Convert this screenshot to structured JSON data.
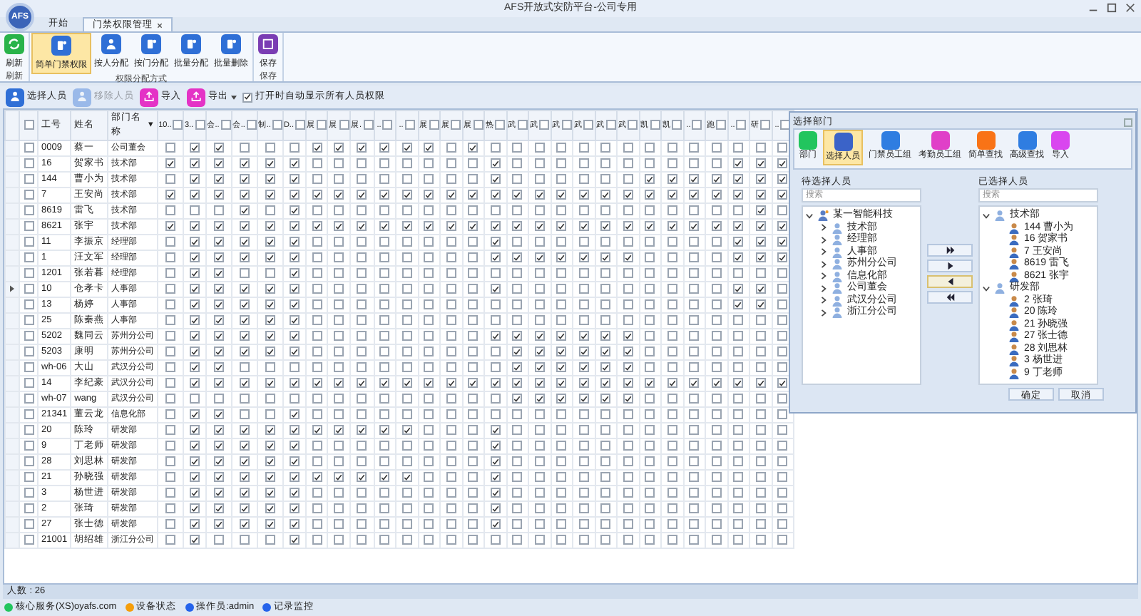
{
  "window": {
    "title": "AFS开放式安防平台-公司专用",
    "logo": "AFS"
  },
  "tabs": [
    {
      "label": "开始",
      "selected": false,
      "closable": false
    },
    {
      "label": "门禁权限管理",
      "selected": true,
      "closable": true
    }
  ],
  "ribbon_groups": [
    {
      "label": "刷新",
      "buttons": [
        {
          "label": "刷新",
          "selected": false
        }
      ]
    },
    {
      "label": "权限分配方式",
      "buttons": [
        {
          "label": "简单门禁权限",
          "selected": true
        },
        {
          "label": "按人分配",
          "selected": false
        },
        {
          "label": "按门分配",
          "selected": false
        },
        {
          "label": "批量分配",
          "selected": false
        },
        {
          "label": "批量删除",
          "selected": false
        }
      ]
    },
    {
      "label": "保存",
      "buttons": [
        {
          "label": "保存",
          "selected": false
        }
      ]
    }
  ],
  "toolbar": {
    "buttons": [
      {
        "label": "选择人员",
        "disabled": false,
        "dropdown": false
      },
      {
        "label": "移除人员",
        "disabled": true,
        "dropdown": false
      },
      {
        "label": "导入",
        "disabled": false,
        "dropdown": false
      },
      {
        "label": "导出",
        "disabled": false,
        "dropdown": true
      }
    ],
    "option": {
      "label": "打开时自动显示所有人员权限",
      "checked": true
    }
  },
  "table": {
    "all_checked": false,
    "columns": [
      "工号",
      "姓名",
      "部门名称"
    ],
    "sort_indicator": "▾",
    "permission_columns": [
      {
        "label": "10..",
        "checked": false
      },
      {
        "label": "3..",
        "checked": false
      },
      {
        "label": "会..",
        "checked": false
      },
      {
        "label": "会..",
        "checked": false
      },
      {
        "label": "制..",
        "checked": false
      },
      {
        "label": "D..",
        "checked": false
      },
      {
        "label": "展",
        "checked": false
      },
      {
        "label": "展",
        "checked": false
      },
      {
        "label": "展.",
        "checked": false
      },
      {
        "label": "..",
        "checked": false
      },
      {
        "label": "..",
        "checked": false
      },
      {
        "label": "展",
        "checked": false
      },
      {
        "label": "展",
        "checked": false
      },
      {
        "label": "展",
        "checked": false
      },
      {
        "label": "热",
        "checked": false
      },
      {
        "label": "武",
        "checked": false
      },
      {
        "label": "武",
        "checked": false
      },
      {
        "label": "武",
        "checked": false
      },
      {
        "label": "武",
        "checked": false
      },
      {
        "label": "武",
        "checked": false
      },
      {
        "label": "武",
        "checked": false
      },
      {
        "label": "凯",
        "checked": false
      },
      {
        "label": "凯",
        "checked": false
      },
      {
        "label": "..",
        "checked": false
      },
      {
        "label": "跑",
        "checked": false
      },
      {
        "label": "..",
        "checked": false
      },
      {
        "label": "研",
        "checked": false
      },
      {
        "label": "..",
        "checked": false
      }
    ],
    "rows": [
      {
        "id": "0009",
        "name": "蔡一",
        "dept": "公司董会",
        "checked": false,
        "current": false,
        "permissions": [
          false,
          true,
          true,
          false,
          false,
          false,
          true,
          true,
          true,
          true,
          true,
          true,
          false,
          true,
          false,
          false,
          false,
          false,
          false,
          false,
          false,
          false,
          false,
          false,
          false,
          false,
          false,
          false
        ]
      },
      {
        "id": "16",
        "name": "贺家书",
        "dept": "技术部",
        "checked": false,
        "current": false,
        "permissions": [
          true,
          true,
          true,
          true,
          true,
          true,
          false,
          false,
          false,
          false,
          false,
          false,
          false,
          false,
          true,
          false,
          false,
          false,
          false,
          false,
          false,
          false,
          false,
          false,
          false,
          true,
          true,
          true
        ]
      },
      {
        "id": "144",
        "name": "曹小为",
        "dept": "技术部",
        "checked": false,
        "current": false,
        "permissions": [
          false,
          true,
          true,
          true,
          true,
          true,
          false,
          false,
          false,
          false,
          false,
          false,
          false,
          false,
          true,
          false,
          false,
          false,
          false,
          false,
          false,
          true,
          true,
          true,
          true,
          true,
          true,
          true
        ]
      },
      {
        "id": "7",
        "name": "王安尚",
        "dept": "技术部",
        "checked": false,
        "current": false,
        "permissions": [
          true,
          true,
          true,
          true,
          true,
          true,
          true,
          true,
          true,
          true,
          true,
          true,
          true,
          true,
          true,
          true,
          true,
          true,
          true,
          true,
          true,
          true,
          true,
          true,
          true,
          true,
          true,
          true
        ]
      },
      {
        "id": "8619",
        "name": "雷飞",
        "dept": "技术部",
        "checked": false,
        "current": false,
        "permissions": [
          false,
          false,
          false,
          true,
          false,
          true,
          false,
          false,
          false,
          false,
          false,
          false,
          false,
          false,
          false,
          false,
          false,
          false,
          false,
          false,
          false,
          false,
          false,
          false,
          false,
          false,
          true,
          false
        ]
      },
      {
        "id": "8621",
        "name": "张宇",
        "dept": "技术部",
        "checked": false,
        "current": false,
        "permissions": [
          true,
          true,
          true,
          true,
          true,
          true,
          true,
          true,
          true,
          true,
          true,
          true,
          true,
          true,
          true,
          true,
          true,
          true,
          true,
          true,
          true,
          true,
          true,
          true,
          true,
          true,
          true,
          true
        ]
      },
      {
        "id": "11",
        "name": "李振京",
        "dept": "经理部",
        "checked": false,
        "current": false,
        "permissions": [
          false,
          true,
          true,
          true,
          true,
          true,
          false,
          false,
          false,
          false,
          false,
          false,
          false,
          false,
          true,
          false,
          false,
          false,
          false,
          false,
          false,
          false,
          false,
          false,
          false,
          true,
          true,
          true
        ]
      },
      {
        "id": "1",
        "name": "汪文军",
        "dept": "经理部",
        "checked": false,
        "current": false,
        "permissions": [
          false,
          true,
          true,
          true,
          true,
          true,
          false,
          false,
          false,
          false,
          false,
          false,
          false,
          false,
          true,
          true,
          true,
          true,
          true,
          true,
          true,
          false,
          false,
          false,
          false,
          true,
          true,
          true
        ]
      },
      {
        "id": "1201",
        "name": "张若暮",
        "dept": "经理部",
        "checked": false,
        "current": false,
        "permissions": [
          false,
          true,
          true,
          false,
          false,
          true,
          false,
          false,
          false,
          false,
          false,
          false,
          false,
          false,
          false,
          false,
          false,
          false,
          false,
          false,
          false,
          false,
          false,
          false,
          false,
          false,
          false,
          false
        ]
      },
      {
        "id": "10",
        "name": "仓孝卡",
        "dept": "人事部",
        "checked": false,
        "current": true,
        "permissions": [
          false,
          true,
          true,
          true,
          true,
          true,
          false,
          false,
          false,
          false,
          false,
          false,
          false,
          false,
          true,
          false,
          false,
          false,
          false,
          false,
          false,
          false,
          false,
          false,
          false,
          true,
          true,
          false
        ]
      },
      {
        "id": "13",
        "name": "杨婷",
        "dept": "人事部",
        "checked": false,
        "current": false,
        "permissions": [
          false,
          true,
          true,
          true,
          true,
          true,
          false,
          false,
          false,
          false,
          false,
          false,
          false,
          false,
          false,
          false,
          false,
          false,
          false,
          false,
          false,
          false,
          false,
          false,
          false,
          true,
          true,
          false
        ]
      },
      {
        "id": "25",
        "name": "陈秦燕",
        "dept": "人事部",
        "checked": false,
        "current": false,
        "permissions": [
          false,
          true,
          true,
          true,
          true,
          true,
          false,
          false,
          false,
          false,
          false,
          false,
          false,
          false,
          false,
          false,
          false,
          false,
          false,
          false,
          false,
          false,
          false,
          false,
          false,
          false,
          false,
          false
        ]
      },
      {
        "id": "5202",
        "name": "魏同云",
        "dept": "苏州分公司",
        "checked": false,
        "current": false,
        "permissions": [
          false,
          true,
          true,
          true,
          true,
          true,
          false,
          false,
          false,
          false,
          false,
          false,
          false,
          false,
          true,
          true,
          true,
          true,
          true,
          true,
          true,
          false,
          false,
          false,
          false,
          false,
          false,
          false
        ]
      },
      {
        "id": "5203",
        "name": "康明",
        "dept": "苏州分公司",
        "checked": false,
        "current": false,
        "permissions": [
          false,
          true,
          true,
          true,
          true,
          true,
          false,
          false,
          false,
          false,
          false,
          false,
          false,
          false,
          false,
          true,
          true,
          true,
          true,
          true,
          true,
          false,
          false,
          false,
          false,
          false,
          false,
          false
        ]
      },
      {
        "id": "wh-06",
        "name": "大山",
        "dept": "武汉分公司",
        "checked": false,
        "current": false,
        "permissions": [
          false,
          true,
          true,
          false,
          false,
          false,
          false,
          false,
          false,
          false,
          false,
          false,
          false,
          false,
          false,
          true,
          true,
          true,
          true,
          true,
          true,
          false,
          false,
          false,
          false,
          false,
          false,
          false
        ]
      },
      {
        "id": "14",
        "name": "李纪豪",
        "dept": "武汉分公司",
        "checked": false,
        "current": false,
        "permissions": [
          false,
          true,
          true,
          true,
          true,
          true,
          true,
          true,
          true,
          true,
          true,
          true,
          true,
          true,
          true,
          true,
          true,
          true,
          true,
          true,
          true,
          true,
          true,
          true,
          true,
          true,
          true,
          true
        ]
      },
      {
        "id": "wh-07",
        "name": "wang",
        "dept": "武汉分公司",
        "checked": false,
        "current": false,
        "permissions": [
          false,
          false,
          false,
          false,
          false,
          false,
          false,
          false,
          false,
          false,
          false,
          false,
          false,
          false,
          false,
          true,
          true,
          true,
          true,
          true,
          true,
          false,
          false,
          false,
          false,
          false,
          false,
          false
        ]
      },
      {
        "id": "21341",
        "name": "董云龙",
        "dept": "信息化部",
        "checked": false,
        "current": false,
        "permissions": [
          false,
          true,
          true,
          false,
          false,
          true,
          false,
          false,
          false,
          false,
          false,
          false,
          false,
          false,
          false,
          false,
          false,
          false,
          false,
          false,
          false,
          false,
          false,
          false,
          false,
          false,
          false,
          false
        ]
      },
      {
        "id": "20",
        "name": "陈玲",
        "dept": "研发部",
        "checked": false,
        "current": false,
        "permissions": [
          false,
          true,
          true,
          true,
          true,
          true,
          true,
          true,
          true,
          true,
          true,
          false,
          false,
          false,
          true,
          false,
          false,
          false,
          false,
          false,
          false,
          false,
          false,
          false,
          false,
          false,
          false,
          false
        ]
      },
      {
        "id": "9",
        "name": "丁老师",
        "dept": "研发部",
        "checked": false,
        "current": false,
        "permissions": [
          false,
          true,
          true,
          true,
          true,
          true,
          false,
          false,
          false,
          false,
          false,
          false,
          false,
          false,
          true,
          false,
          false,
          false,
          false,
          false,
          false,
          false,
          false,
          false,
          false,
          false,
          false,
          false
        ]
      },
      {
        "id": "28",
        "name": "刘思林",
        "dept": "研发部",
        "checked": false,
        "current": false,
        "permissions": [
          false,
          true,
          true,
          true,
          true,
          true,
          false,
          false,
          false,
          false,
          false,
          false,
          false,
          false,
          true,
          false,
          false,
          false,
          false,
          false,
          false,
          false,
          false,
          false,
          false,
          false,
          false,
          false
        ]
      },
      {
        "id": "21",
        "name": "孙晓强",
        "dept": "研发部",
        "checked": false,
        "current": false,
        "permissions": [
          false,
          true,
          true,
          true,
          true,
          true,
          true,
          true,
          true,
          true,
          true,
          false,
          false,
          false,
          true,
          false,
          false,
          false,
          false,
          false,
          false,
          false,
          false,
          false,
          false,
          false,
          false,
          false
        ]
      },
      {
        "id": "3",
        "name": "杨世进",
        "dept": "研发部",
        "checked": false,
        "current": false,
        "permissions": [
          false,
          true,
          true,
          true,
          true,
          true,
          false,
          false,
          false,
          false,
          false,
          false,
          false,
          false,
          true,
          false,
          false,
          false,
          false,
          false,
          false,
          false,
          false,
          false,
          false,
          false,
          false,
          false
        ]
      },
      {
        "id": "2",
        "name": "张琦",
        "dept": "研发部",
        "checked": false,
        "current": false,
        "permissions": [
          false,
          true,
          true,
          true,
          true,
          true,
          false,
          false,
          false,
          false,
          false,
          false,
          false,
          false,
          true,
          false,
          false,
          false,
          false,
          false,
          false,
          false,
          false,
          false,
          false,
          false,
          false,
          false
        ]
      },
      {
        "id": "27",
        "name": "张士德",
        "dept": "研发部",
        "checked": false,
        "current": false,
        "permissions": [
          false,
          true,
          true,
          true,
          true,
          true,
          false,
          false,
          false,
          false,
          false,
          false,
          false,
          false,
          true,
          false,
          false,
          false,
          false,
          false,
          false,
          false,
          false,
          false,
          false,
          false,
          false,
          false
        ]
      },
      {
        "id": "21001",
        "name": "胡绍雄",
        "dept": "浙江分公司",
        "checked": false,
        "current": false,
        "permissions": [
          false,
          true,
          false,
          false,
          false,
          true,
          false,
          false,
          false,
          false,
          false,
          false,
          false,
          false,
          false,
          false,
          false,
          false,
          false,
          false,
          false,
          false,
          false,
          false,
          false,
          false,
          false,
          false
        ]
      }
    ],
    "footer": "人数 : 26"
  },
  "dialog": {
    "title": "选择部门",
    "toolbar": [
      {
        "label": "部门",
        "color": "#22c55e",
        "selected": false
      },
      {
        "label": "选择人员",
        "color": "#3b63c8",
        "selected": true
      },
      {
        "label": "门禁员工组",
        "color": "#2f7de1",
        "selected": false
      },
      {
        "label": "考勤员工组",
        "color": "#e040c8",
        "selected": false
      },
      {
        "label": "简单查找",
        "color": "#f97316",
        "selected": false
      },
      {
        "label": "高级查找",
        "color": "#2f7de1",
        "selected": false
      },
      {
        "label": "导入",
        "color": "#d946ef",
        "selected": false
      }
    ],
    "left": {
      "label": "待选择人员",
      "placeholder": "搜索",
      "tree": [
        {
          "label": "某一智能科技",
          "kind": "org",
          "expanded": true,
          "children": [
            {
              "label": "技术部",
              "kind": "dept",
              "expanded": false
            },
            {
              "label": "经理部",
              "kind": "dept",
              "expanded": false
            },
            {
              "label": "人事部",
              "kind": "dept",
              "expanded": false
            },
            {
              "label": "苏州分公司",
              "kind": "dept",
              "expanded": false
            },
            {
              "label": "信息化部",
              "kind": "dept",
              "expanded": false
            },
            {
              "label": "公司董会",
              "kind": "dept",
              "expanded": false
            },
            {
              "label": "武汉分公司",
              "kind": "dept",
              "expanded": false
            },
            {
              "label": "浙江分公司",
              "kind": "dept",
              "expanded": false
            }
          ]
        }
      ]
    },
    "move_buttons": [
      {
        "kind": "all_right",
        "selected": false
      },
      {
        "kind": "right",
        "selected": false
      },
      {
        "kind": "left",
        "selected": true
      },
      {
        "kind": "all_left",
        "selected": false
      }
    ],
    "right": {
      "label": "已选择人员",
      "placeholder": "搜索",
      "tree": [
        {
          "label": "技术部",
          "kind": "dept",
          "expanded": true,
          "children": [
            {
              "label": "144 曹小为",
              "kind": "person"
            },
            {
              "label": "16 贺家书",
              "kind": "person"
            },
            {
              "label": "7 王安尚",
              "kind": "person"
            },
            {
              "label": "8619 雷飞",
              "kind": "person"
            },
            {
              "label": "8621 张宇",
              "kind": "person"
            }
          ]
        },
        {
          "label": "研发部",
          "kind": "dept",
          "expanded": true,
          "children": [
            {
              "label": "2 张琦",
              "kind": "person"
            },
            {
              "label": "20 陈玲",
              "kind": "person"
            },
            {
              "label": "21 孙晓强",
              "kind": "person"
            },
            {
              "label": "27 张士德",
              "kind": "person"
            },
            {
              "label": "28 刘思林",
              "kind": "person"
            },
            {
              "label": "3 杨世进",
              "kind": "person"
            },
            {
              "label": "9 丁老师",
              "kind": "person"
            }
          ]
        }
      ]
    },
    "buttons": [
      "确定",
      "取消"
    ]
  },
  "status_bar": [
    {
      "label": "核心服务(XS)oyafs.com",
      "color": "#22c55e"
    },
    {
      "label": "设备状态",
      "color": "#f59e0b"
    },
    {
      "label": "操作员:admin",
      "color": "#2563eb"
    },
    {
      "label": "记录监控",
      "color": "#2563eb"
    }
  ]
}
